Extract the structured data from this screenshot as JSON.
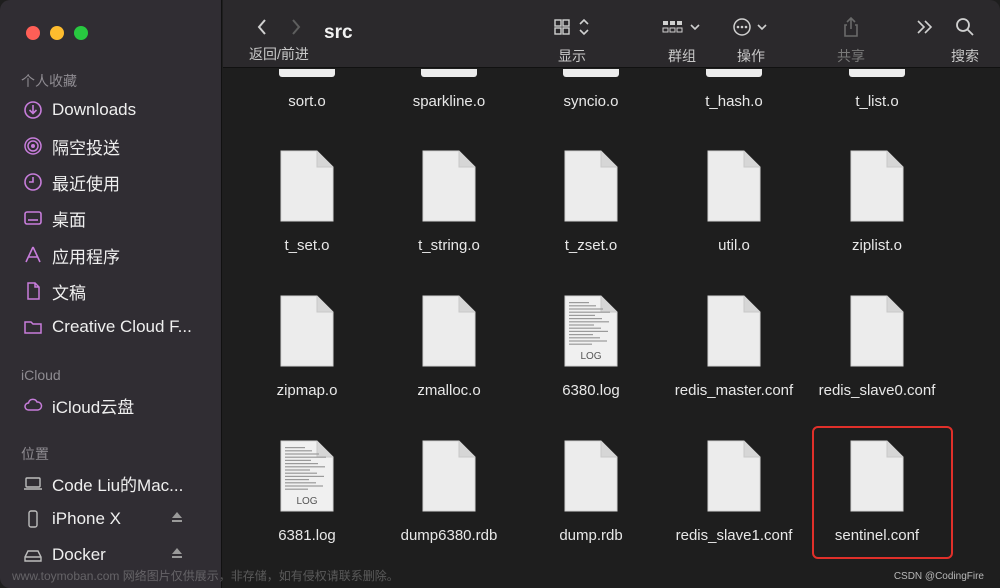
{
  "sidebar": {
    "favorites_title": "个人收藏",
    "favorites": [
      {
        "label": "Downloads",
        "icon": "download-icon"
      },
      {
        "label": "隔空投送",
        "icon": "airdrop-icon"
      },
      {
        "label": "最近使用",
        "icon": "clock-icon"
      },
      {
        "label": "桌面",
        "icon": "desktop-icon"
      },
      {
        "label": "应用程序",
        "icon": "applications-icon"
      },
      {
        "label": "文稿",
        "icon": "document-icon"
      },
      {
        "label": "Creative Cloud F...",
        "icon": "folder-icon"
      }
    ],
    "icloud_title": "iCloud",
    "icloud": [
      {
        "label": "iCloud云盘",
        "icon": "cloud-icon"
      }
    ],
    "locations_title": "位置",
    "locations": [
      {
        "label": "Code Liu的Mac...",
        "icon": "laptop-icon"
      },
      {
        "label": "iPhone X",
        "icon": "phone-icon"
      },
      {
        "label": "Docker",
        "icon": "drive-icon"
      }
    ]
  },
  "toolbar": {
    "back_forward_label": "返回/前进",
    "folder_title": "src",
    "view_label": "显示",
    "group_label": "群组",
    "action_label": "操作",
    "share_label": "共享",
    "search_label": "搜索"
  },
  "files": {
    "row0": [
      "sort.o",
      "sparkline.o",
      "syncio.o",
      "t_hash.o",
      "t_list.o"
    ],
    "row1": [
      "t_set.o",
      "t_string.o",
      "t_zset.o",
      "util.o",
      "ziplist.o"
    ],
    "row2": [
      "zipmap.o",
      "zmalloc.o",
      "6380.log",
      "redis_master.conf",
      "redis_slave0.conf"
    ],
    "row3": [
      "6381.log",
      "dump6380.rdb",
      "dump.rdb",
      "redis_slave1.conf",
      "sentinel.conf"
    ],
    "log_tag": "LOG"
  },
  "colors": {
    "highlight": "#e0302a",
    "accent_icon": "#c77ddb"
  },
  "footer": {
    "watermark": "www.toymoban.com 网络图片仅供展示，非存储，如有侵权请联系删除。",
    "credit": "CSDN @CodingFire"
  }
}
